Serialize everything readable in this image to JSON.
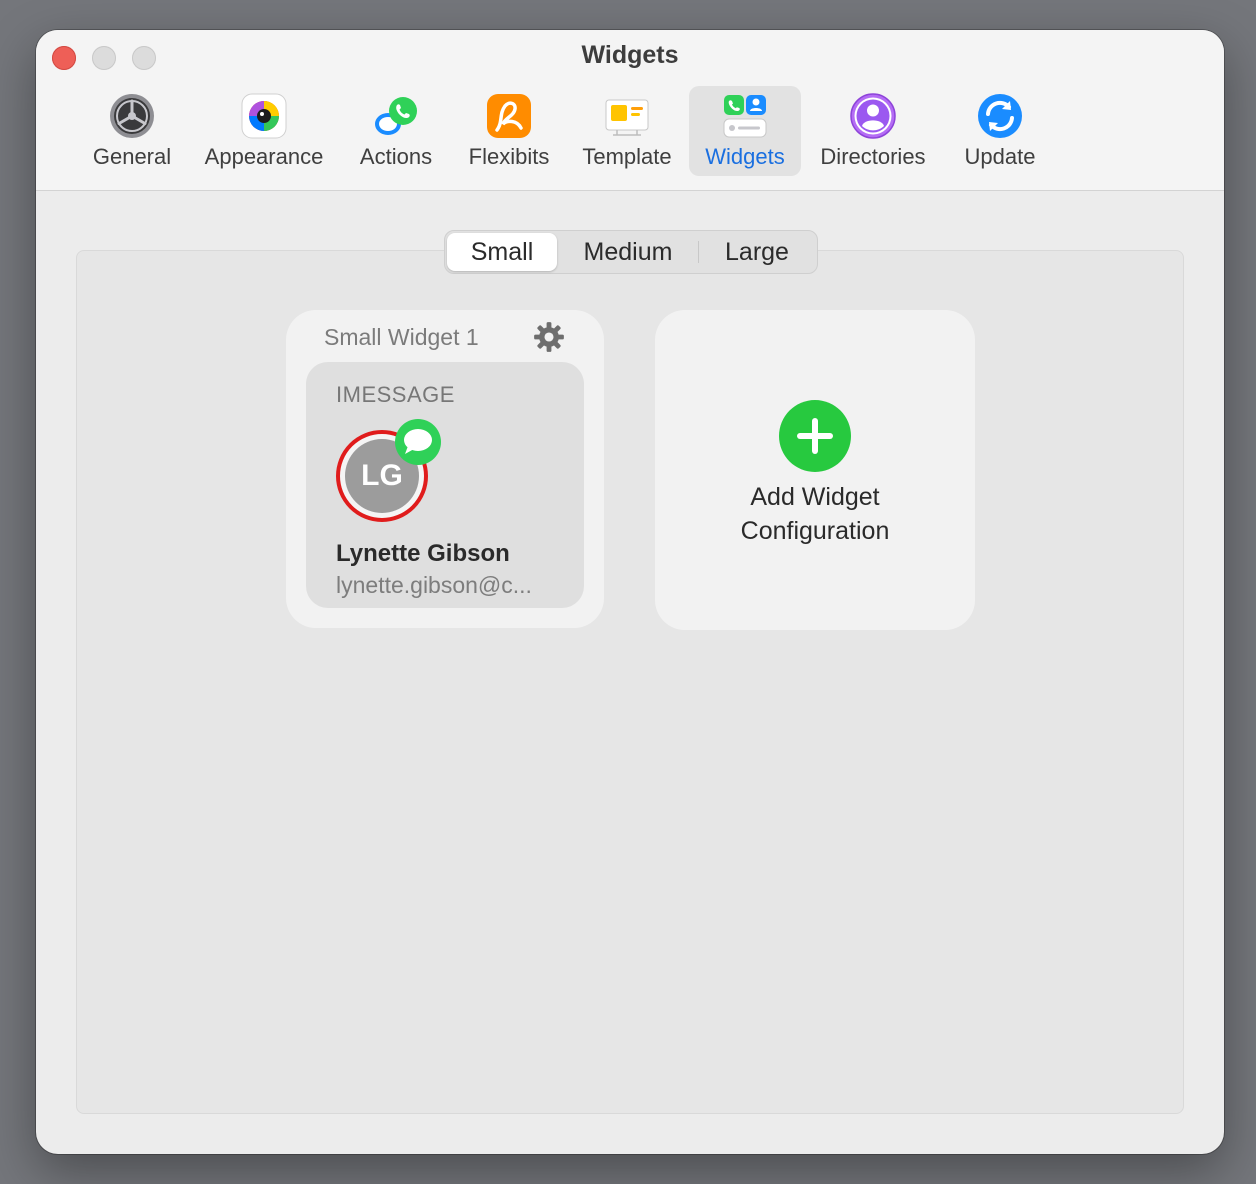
{
  "window": {
    "title": "Widgets"
  },
  "toolbar": {
    "items": [
      {
        "label": "General",
        "icon": "general-settings-icon"
      },
      {
        "label": "Appearance",
        "icon": "appearance-color-wheel-icon"
      },
      {
        "label": "Actions",
        "icon": "actions-chat-phone-icon"
      },
      {
        "label": "Flexibits",
        "icon": "flexibits-logo-icon"
      },
      {
        "label": "Template",
        "icon": "template-icon"
      },
      {
        "label": "Widgets",
        "icon": "widgets-icon",
        "selected": true
      },
      {
        "label": "Directories",
        "icon": "directories-person-icon"
      },
      {
        "label": "Update",
        "icon": "update-sync-icon"
      }
    ]
  },
  "size_selector": {
    "options": [
      "Small",
      "Medium",
      "Large"
    ],
    "selected": "Small"
  },
  "widgets": [
    {
      "title": "Small Widget 1",
      "type_label": "IMESSAGE",
      "contact": {
        "initials": "LG",
        "name": "Lynette Gibson",
        "email": "lynette.gibson@c..."
      }
    }
  ],
  "add_widget": {
    "label_line1": "Add Widget",
    "label_line2": "Configuration"
  },
  "colors": {
    "accent": "#1a6fe0",
    "close": "#ee5f57",
    "add_green": "#27c93f",
    "ring_red": "#e01c1c",
    "imessage_green": "#2fd158"
  }
}
